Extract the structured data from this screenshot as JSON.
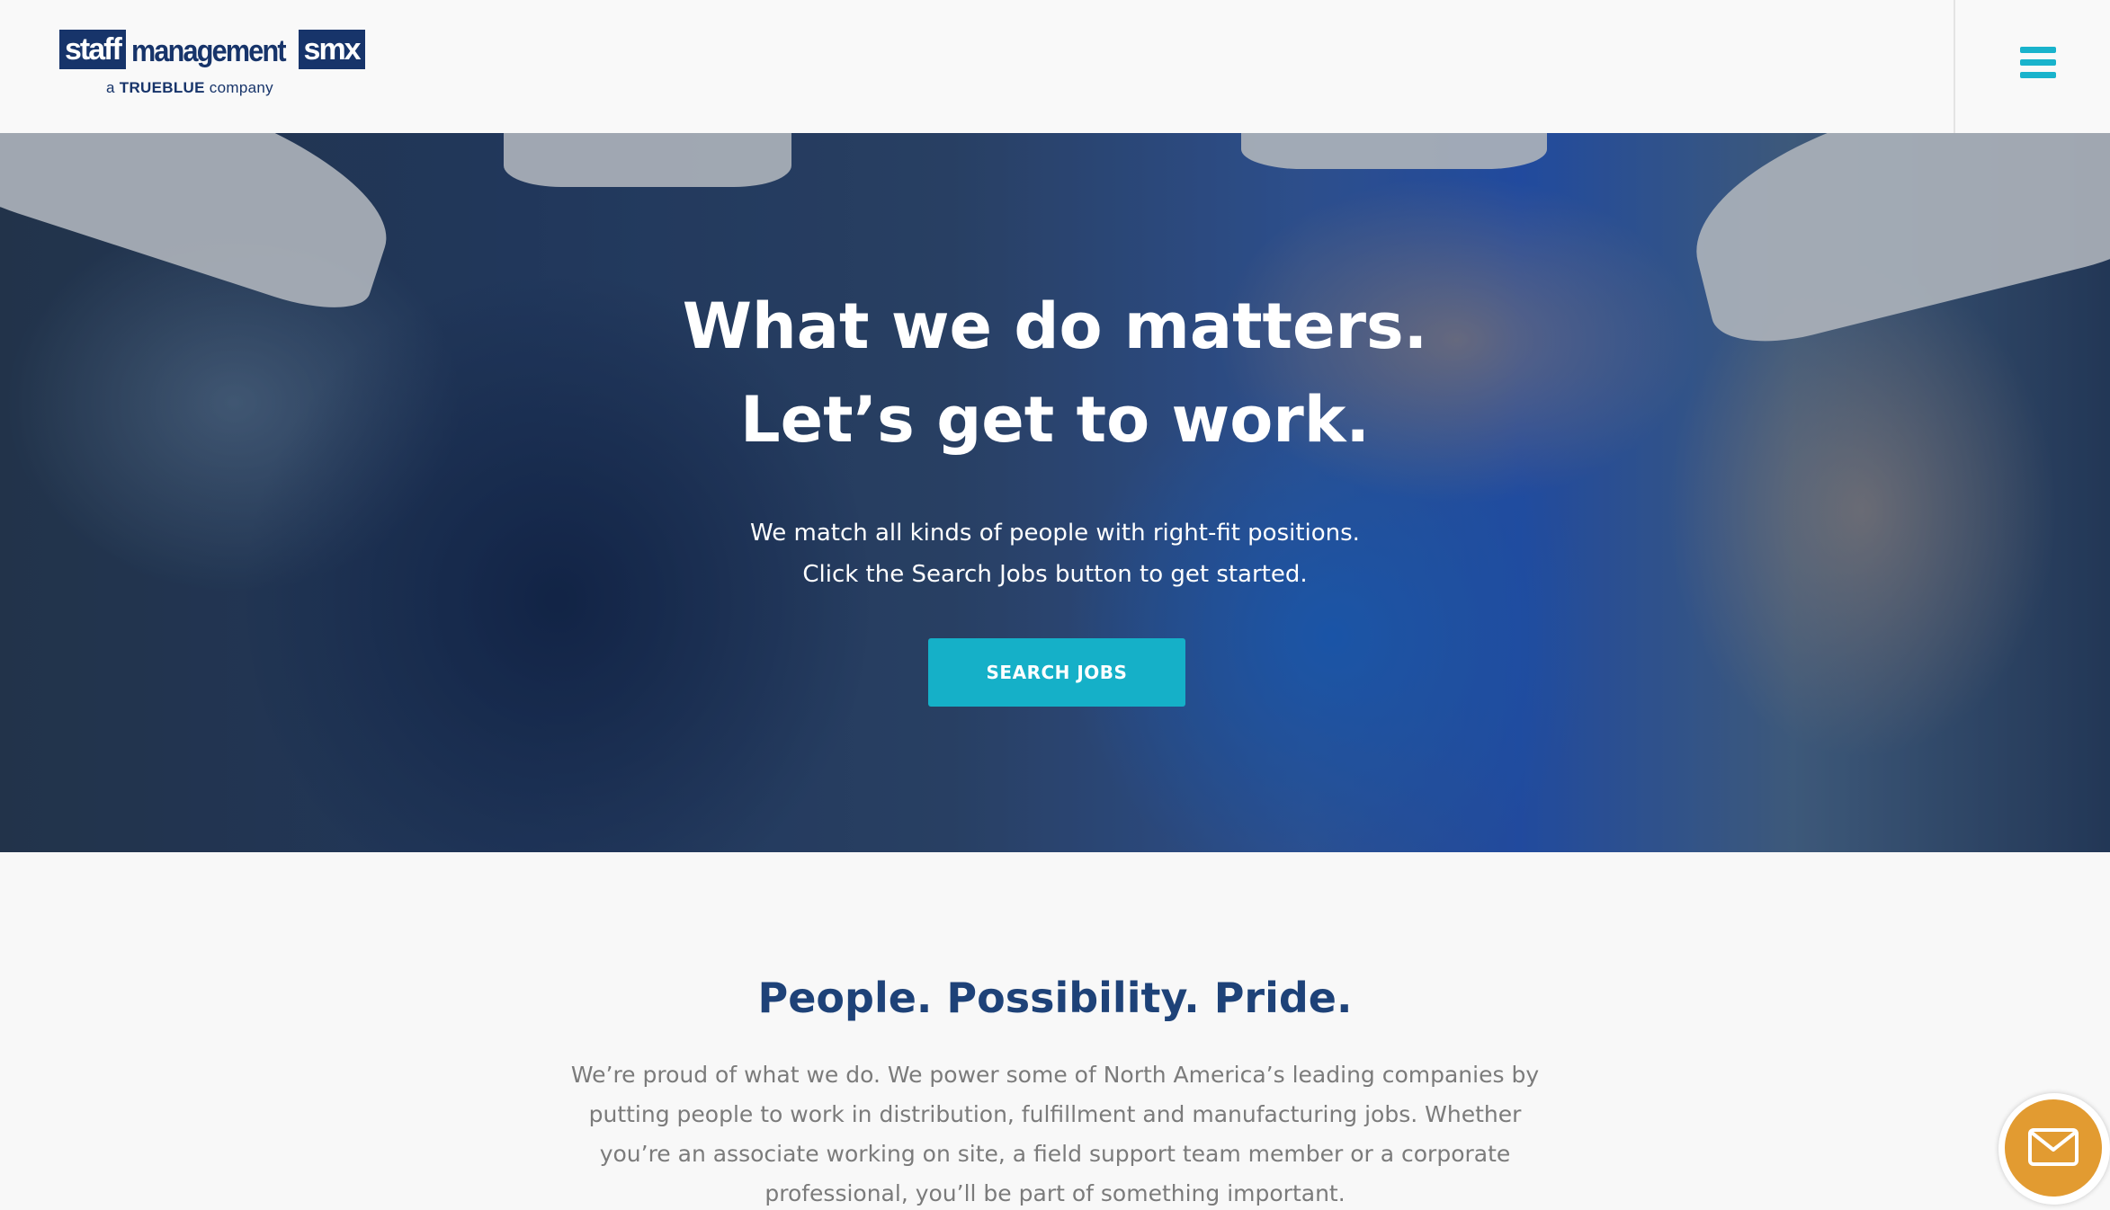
{
  "header": {
    "logo": {
      "staff": "staff",
      "management": "management",
      "smx": "smx",
      "tag_prefix": "a",
      "tag_brand": "TRUEBLUE",
      "tag_suffix": "company"
    },
    "menu_icon": "hamburger-menu-icon"
  },
  "hero": {
    "title_line1": "What we do matters.",
    "title_line2": "Let’s get to work.",
    "subtitle_line1": "We match all kinds of people with right-fit positions.",
    "subtitle_line2": "Click the Search Jobs button to get started.",
    "cta_label": "SEARCH JOBS"
  },
  "content": {
    "heading": "People. Possibility. Pride.",
    "paragraph": "We’re proud of what we do. We power some of North America’s leading companies by putting people to work in distribution, fulfillment and manufacturing jobs. Whether you’re an associate working on site, a field support team member or a corporate professional, you’ll be part of something important."
  },
  "floating": {
    "icon": "mail-icon"
  },
  "colors": {
    "brand_navy": "#17346a",
    "accent_teal": "#15b0c8",
    "heading_blue": "#1e4278",
    "mail_orange": "#e29b31"
  }
}
